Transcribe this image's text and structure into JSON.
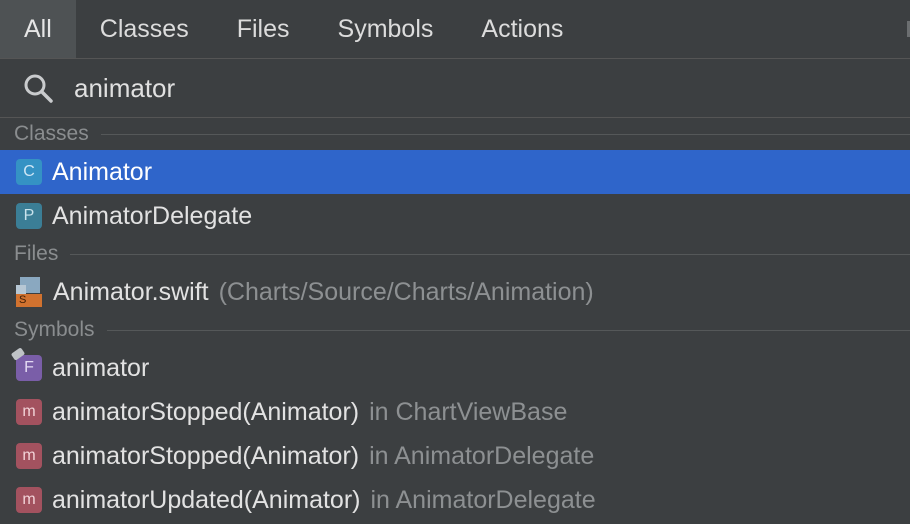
{
  "tabs": [
    {
      "label": "All"
    },
    {
      "label": "Classes"
    },
    {
      "label": "Files"
    },
    {
      "label": "Symbols"
    },
    {
      "label": "Actions"
    }
  ],
  "search": {
    "value": "animator",
    "icon": "search-icon"
  },
  "sections": {
    "classes": {
      "title": "Classes",
      "items": [
        {
          "badge": "C",
          "name": "Animator",
          "selected": true
        },
        {
          "badge": "P",
          "name": "AnimatorDelegate"
        }
      ]
    },
    "files": {
      "title": "Files",
      "items": [
        {
          "badge": "S",
          "name": "Animator.swift",
          "path": "(Charts/Source/Charts/Animation)"
        }
      ]
    },
    "symbols": {
      "title": "Symbols",
      "items": [
        {
          "badge": "F",
          "name": "animator"
        },
        {
          "badge": "m",
          "name": "animatorStopped(Animator)",
          "context": "in ChartViewBase"
        },
        {
          "badge": "m",
          "name": "animatorStopped(Animator)",
          "context": "in AnimatorDelegate"
        },
        {
          "badge": "m",
          "name": "animatorUpdated(Animator)",
          "context": "in AnimatorDelegate"
        }
      ]
    }
  },
  "colors": {
    "background": "#3c3f41",
    "selection": "#2f65ca",
    "class_badge": "#3592c4",
    "protocol_badge": "#3b7e96",
    "field_badge": "#7a5ea8",
    "method_badge": "#a3525f",
    "swift_file": "#d1722f"
  }
}
